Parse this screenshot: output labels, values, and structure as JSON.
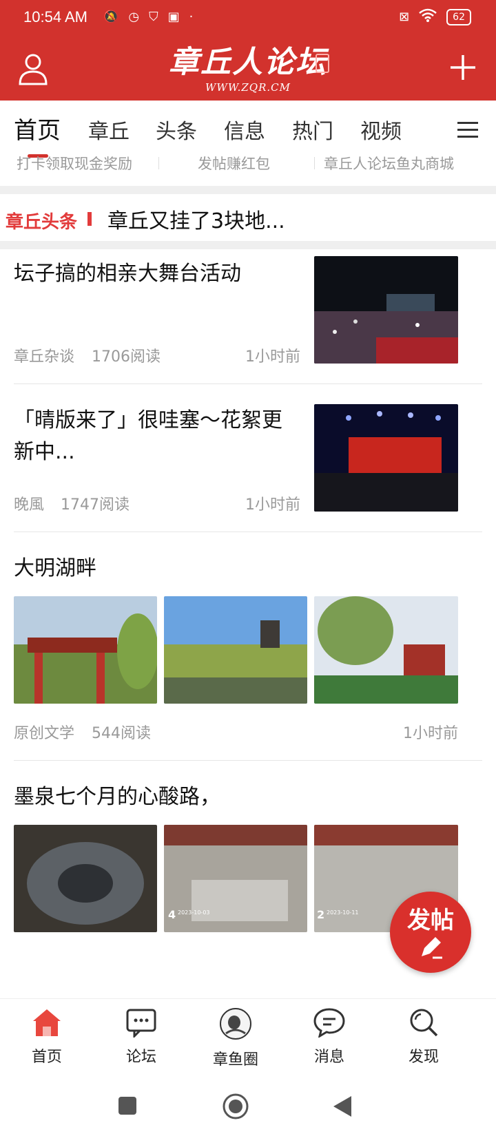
{
  "status": {
    "time": "10:54 AM",
    "battery": "62"
  },
  "header": {
    "logo_text": "章丘人论坛",
    "logo_url": "WWW.ZQR.CM"
  },
  "tabs": [
    "首页",
    "章丘",
    "头条",
    "信息",
    "热门",
    "视频"
  ],
  "promo_links": [
    "打卡领取现金奖励",
    "发帖赚红包",
    "章丘人论坛鱼丸商城"
  ],
  "headline": {
    "tag": "章丘头条",
    "text": "章丘又挂了3块地..."
  },
  "posts": [
    {
      "title": "坛子搞的相亲大舞台活动",
      "source": "章丘杂谈",
      "reads": "1706阅读",
      "time": "1小时前"
    },
    {
      "title_line1": "「晴版来了」很哇塞～花絮更",
      "title_line2": "新中...",
      "source": "晚風",
      "reads": "1747阅读",
      "time": "1小时前"
    },
    {
      "title": "大明湖畔",
      "source": "原创文学",
      "reads": "544阅读",
      "time": "1小时前"
    },
    {
      "title": "墨泉七个月的心酸路，",
      "photo_dates": [
        "2023-10-03",
        "2023-10-11"
      ]
    }
  ],
  "fab": {
    "label": "发帖"
  },
  "bottom_nav": [
    "首页",
    "论坛",
    "章鱼圈",
    "消息",
    "发现"
  ],
  "colors": {
    "brand": "#d2322d",
    "accent": "#e23b3b"
  }
}
